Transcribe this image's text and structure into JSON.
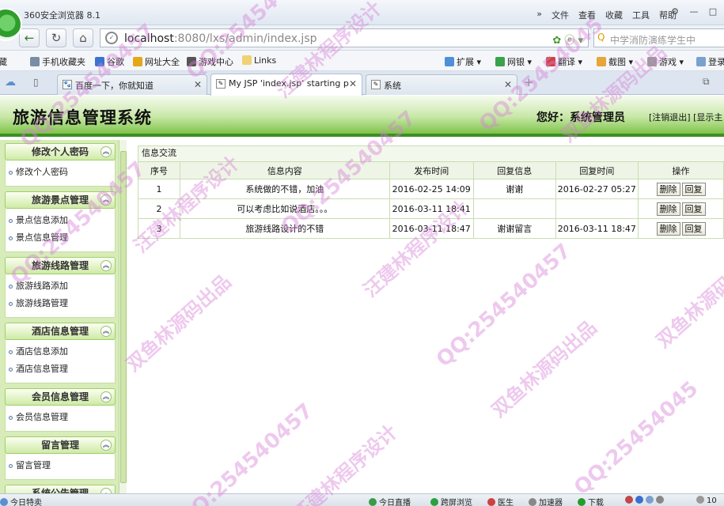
{
  "browser": {
    "title": "360安全浏览器 8.1",
    "menu": [
      "文件",
      "查看",
      "收藏",
      "工具",
      "帮助"
    ],
    "url_host": "localhost",
    "url_rest": ":8080/lxs/admin/index.jsp",
    "search_placeholder": "中学消防演练学生中",
    "bookmarks_left": [
      "藏",
      "手机收藏夹",
      "谷歌",
      "网址大全",
      "游戏中心",
      "Links"
    ],
    "bookmarks_right": [
      "扩展",
      "网银",
      "翻译",
      "截图",
      "游戏",
      "登录"
    ],
    "tabs": [
      {
        "label": "百度一下，你就知道",
        "active": false
      },
      {
        "label": "My JSP 'index.jsp' starting p",
        "active": true
      },
      {
        "label": "系统",
        "active": false
      }
    ],
    "status_left": "今日特卖",
    "status_items": [
      "今日直播",
      "跨屏浏览",
      "医生",
      "加速器",
      "下载"
    ],
    "status_zoom": "10"
  },
  "app": {
    "title": "旅游信息管理系统",
    "user_greeting": "您好：系统管理员",
    "links": "[注销退出] [显示主"
  },
  "sidebar": {
    "sections": [
      {
        "title": "修改个人密码",
        "items": [
          "修改个人密码"
        ]
      },
      {
        "title": "旅游景点管理",
        "items": [
          "景点信息添加",
          "景点信息管理"
        ]
      },
      {
        "title": "旅游线路管理",
        "items": [
          "旅游线路添加",
          "旅游线路管理"
        ]
      },
      {
        "title": "酒店信息管理",
        "items": [
          "酒店信息添加",
          "酒店信息管理"
        ]
      },
      {
        "title": "会员信息管理",
        "items": [
          "会员信息管理"
        ]
      },
      {
        "title": "留言管理",
        "items": [
          "留言管理"
        ]
      },
      {
        "title": "系统公告管理",
        "items": []
      }
    ]
  },
  "main": {
    "panel_title": "信息交流",
    "columns": [
      "序号",
      "信息内容",
      "发布时间",
      "回复信息",
      "回复时间",
      "操作"
    ],
    "rows": [
      {
        "no": "1",
        "content": "系统做的不错，加油",
        "time": "2016-02-25 14:09",
        "reply": "谢谢",
        "reply_time": "2016-02-27 05:27"
      },
      {
        "no": "2",
        "content": "可以考虑比如说酒店。。。",
        "time": "2016-03-11 18:41",
        "reply": "",
        "reply_time": ""
      },
      {
        "no": "3",
        "content": "旅游线路设计的不错",
        "time": "2016-03-11 18:47",
        "reply": "谢谢留言",
        "reply_time": "2016-03-11 18:47"
      }
    ],
    "delete_label": "删除",
    "reply_label": "回复"
  },
  "watermarks": [
    "QQ:25454",
    "汪建林程序设计",
    "QQ:254540457",
    "双鱼林源码出品",
    "QQ:254540457",
    "汪建林程序设计",
    "QQ:254540457",
    "双鱼林源码出品",
    "QQ:254540457",
    "汪建林程序设计",
    "QQ:25454045",
    "双鱼林源码出品",
    "QQ:25454045",
    "汪建林程序设计",
    "QQ:254540457",
    "双鱼林源码出品"
  ]
}
